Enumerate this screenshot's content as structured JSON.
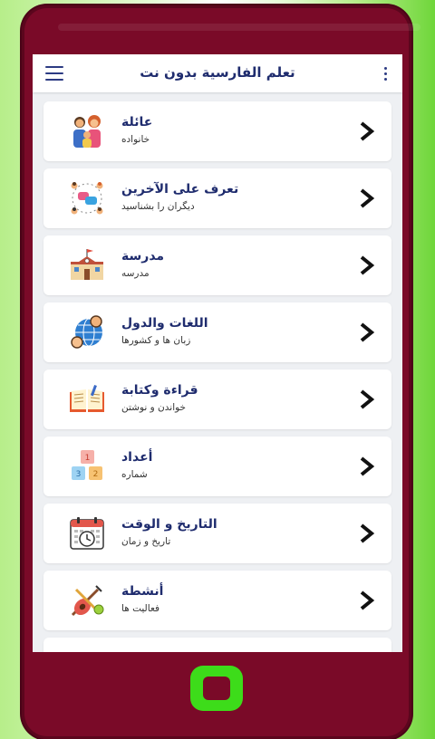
{
  "appbar": {
    "title": "تعلم الفارسية بدون نت",
    "menu_icon": "hamburger-menu-icon",
    "more_icon": "more-vertical-icon"
  },
  "categories": [
    {
      "title": "عائلة",
      "subtitle": "خانواده",
      "icon": "family-icon"
    },
    {
      "title": "تعرف على الآخرين",
      "subtitle": "دیگران را بشناسید",
      "icon": "meeting-people-icon"
    },
    {
      "title": "مدرسة",
      "subtitle": "مدرسه",
      "icon": "school-icon"
    },
    {
      "title": "اللغات والدول",
      "subtitle": "زبان ها و کشورها",
      "icon": "globe-people-icon"
    },
    {
      "title": "قراءة وكتابة",
      "subtitle": "خواندن و نوشتن",
      "icon": "open-book-icon"
    },
    {
      "title": "أعداد",
      "subtitle": "شماره",
      "icon": "number-blocks-icon"
    },
    {
      "title": "التاريخ و الوقت",
      "subtitle": "تاریخ و زمان",
      "icon": "calendar-clock-icon"
    },
    {
      "title": "أنشطة",
      "subtitle": "فعالیت ها",
      "icon": "sports-icon"
    }
  ],
  "colors": {
    "phone_body": "#7a0a28",
    "accent_text": "#1f2c6e",
    "home_button": "#3ddc1a"
  }
}
